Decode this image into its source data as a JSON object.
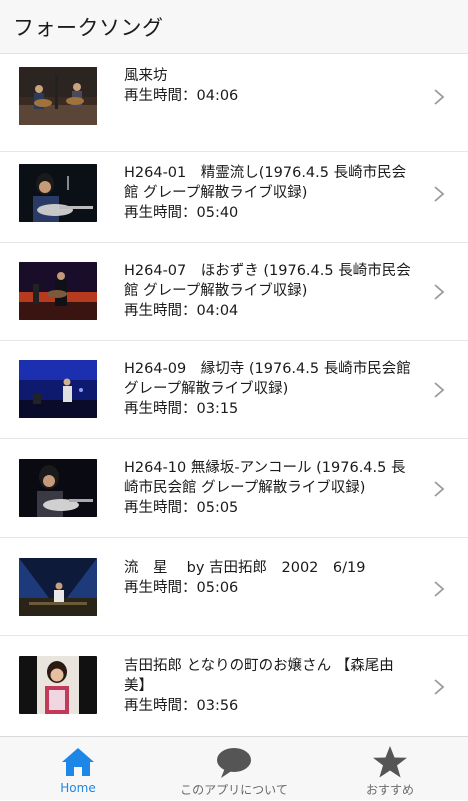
{
  "header": {
    "title": "フォークソング"
  },
  "duration_prefix": "再生時間：",
  "items": [
    {
      "title": "風来坊",
      "duration": "04:06"
    },
    {
      "title": "H264-01　精霊流し(1976.4.5 長崎市民会館 グレープ解散ライブ収録)",
      "duration": "05:40"
    },
    {
      "title": "H264-07　ほおずき (1976.4.5 長崎市民会館 グレープ解散ライブ収録)",
      "duration": "04:04"
    },
    {
      "title": "H264-09　縁切寺 (1976.4.5 長崎市民会館グレープ解散ライブ収録)",
      "duration": "03:15"
    },
    {
      "title": "H264-10 無縁坂-アンコール (1976.4.5 長崎市民会館 グレープ解散ライブ収録)",
      "duration": "05:05"
    },
    {
      "title": "流　星　 by 吉田拓郎　2002　6/19",
      "duration": "05:06"
    },
    {
      "title": "吉田拓郎 となりの町のお嬢さん 【森尾由美】",
      "duration": "03:56"
    }
  ],
  "tabs": [
    {
      "label": "Home",
      "icon": "home-icon",
      "active": true
    },
    {
      "label": "このアプリについて",
      "icon": "speech-bubble-icon",
      "active": false
    },
    {
      "label": "おすすめ",
      "icon": "star-icon",
      "active": false
    }
  ],
  "colors": {
    "accent": "#1e86e6",
    "inactive_tab": "#555555",
    "chevron": "#9b9b9b"
  }
}
